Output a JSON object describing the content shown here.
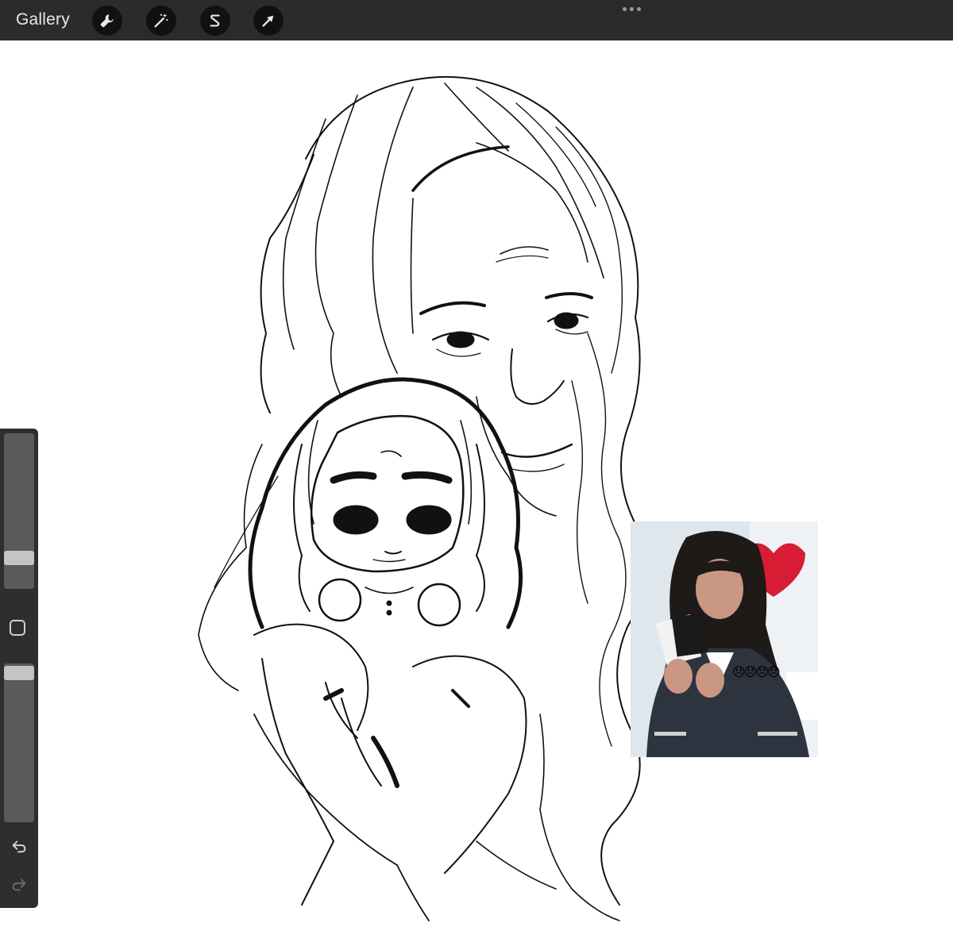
{
  "topbar": {
    "gallery_label": "Gallery",
    "tools": [
      "wrench-icon",
      "magic-wand-icon",
      "selection-s-icon",
      "transform-arrow-icon"
    ],
    "more_icon": "more-dots-icon"
  },
  "sidebar": {
    "brush_size_level": 0.7,
    "opacity_level": 0.1,
    "modifier_icon": "square-modifier-icon",
    "undo_icon": "undo-icon",
    "redo_icon": "redo-icon"
  },
  "reference_photo": {
    "emojis": "😞😞😞😞"
  },
  "colors": {
    "toolbar": "#2b2b2b",
    "sidebar": "#2e2e2e",
    "canvas": "#ffffff"
  }
}
